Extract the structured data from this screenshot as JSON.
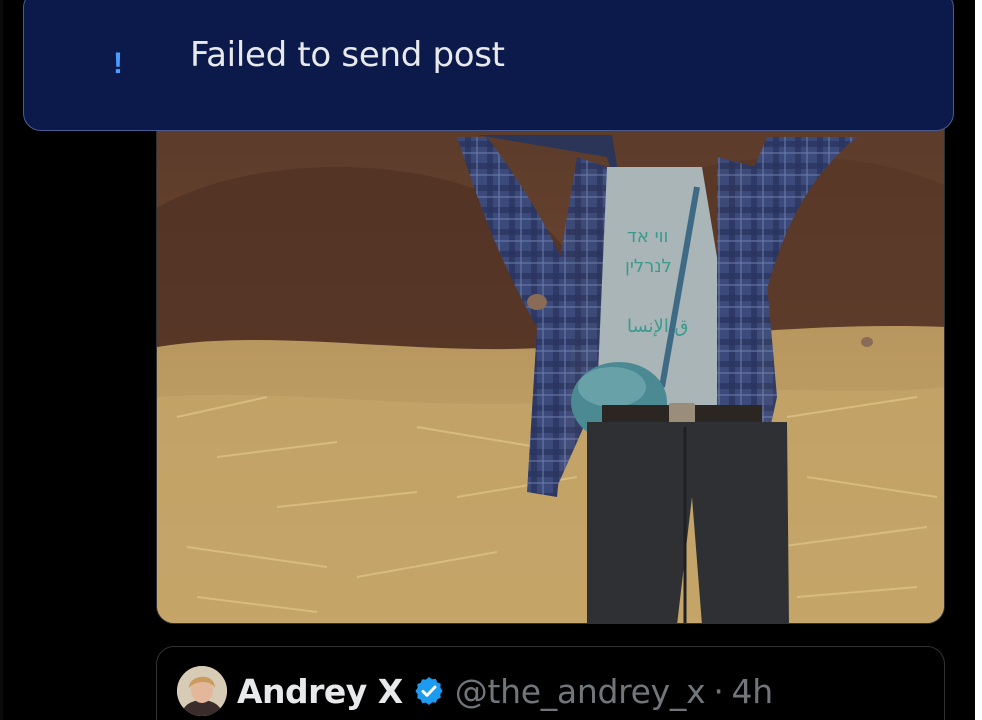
{
  "toast": {
    "icon": "exclamation-icon",
    "message": "Failed to send post",
    "background": "#0b1a4b",
    "accent": "#4a9dff"
  },
  "post": {
    "media": {
      "kind": "photo",
      "description_icon": "photo"
    }
  },
  "quoted_post": {
    "author_name": "Andrey X",
    "verified": true,
    "verified_color": "#1d9bf0",
    "handle": "@the_andrey_x",
    "separator": "·",
    "time": "4h"
  }
}
